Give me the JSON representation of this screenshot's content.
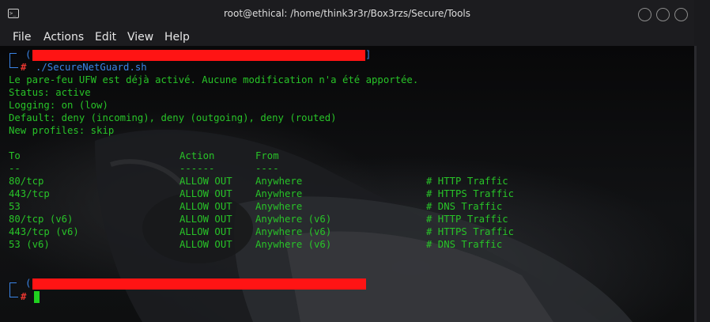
{
  "window": {
    "title": "root@ethical: /home/think3r3r/Box3rzs/Secure/Tools",
    "menu": [
      "File",
      "Actions",
      "Edit",
      "View",
      "Help"
    ]
  },
  "terminal": {
    "command": "./SecureNetGuard.sh",
    "prompt_hash": "#",
    "output": [
      "Le pare-feu UFW est déjà activé. Aucune modification n'a été apportée.",
      "Status: active",
      "Logging: on (low)",
      "Default: deny (incoming), deny (outgoing), deny (routed)",
      "New profiles: skip"
    ],
    "table": {
      "headers": [
        "To",
        "Action",
        "From"
      ],
      "header_underlines": [
        "--",
        "------",
        "----"
      ],
      "rows": [
        {
          "to": "80/tcp",
          "action": "ALLOW OUT",
          "from": "Anywhere",
          "comment": "# HTTP Traffic"
        },
        {
          "to": "443/tcp",
          "action": "ALLOW OUT",
          "from": "Anywhere",
          "comment": "# HTTPS Traffic"
        },
        {
          "to": "53",
          "action": "ALLOW OUT",
          "from": "Anywhere",
          "comment": "# DNS Traffic"
        },
        {
          "to": "80/tcp (v6)",
          "action": "ALLOW OUT",
          "from": "Anywhere (v6)",
          "comment": "# HTTP Traffic"
        },
        {
          "to": "443/tcp (v6)",
          "action": "ALLOW OUT",
          "from": "Anywhere (v6)",
          "comment": "# HTTPS Traffic"
        },
        {
          "to": "53 (v6)",
          "action": "ALLOW OUT",
          "from": "Anywhere (v6)",
          "comment": "# DNS Traffic"
        }
      ]
    }
  },
  "colors": {
    "text_green": "#28c328",
    "prompt_blue": "#3a84e6",
    "hash_red": "#e5362f",
    "redaction_red": "#ff1414"
  },
  "icons": {
    "title": "terminal-icon",
    "window_buttons": [
      "minimize-icon",
      "maximize-icon",
      "close-icon"
    ]
  }
}
